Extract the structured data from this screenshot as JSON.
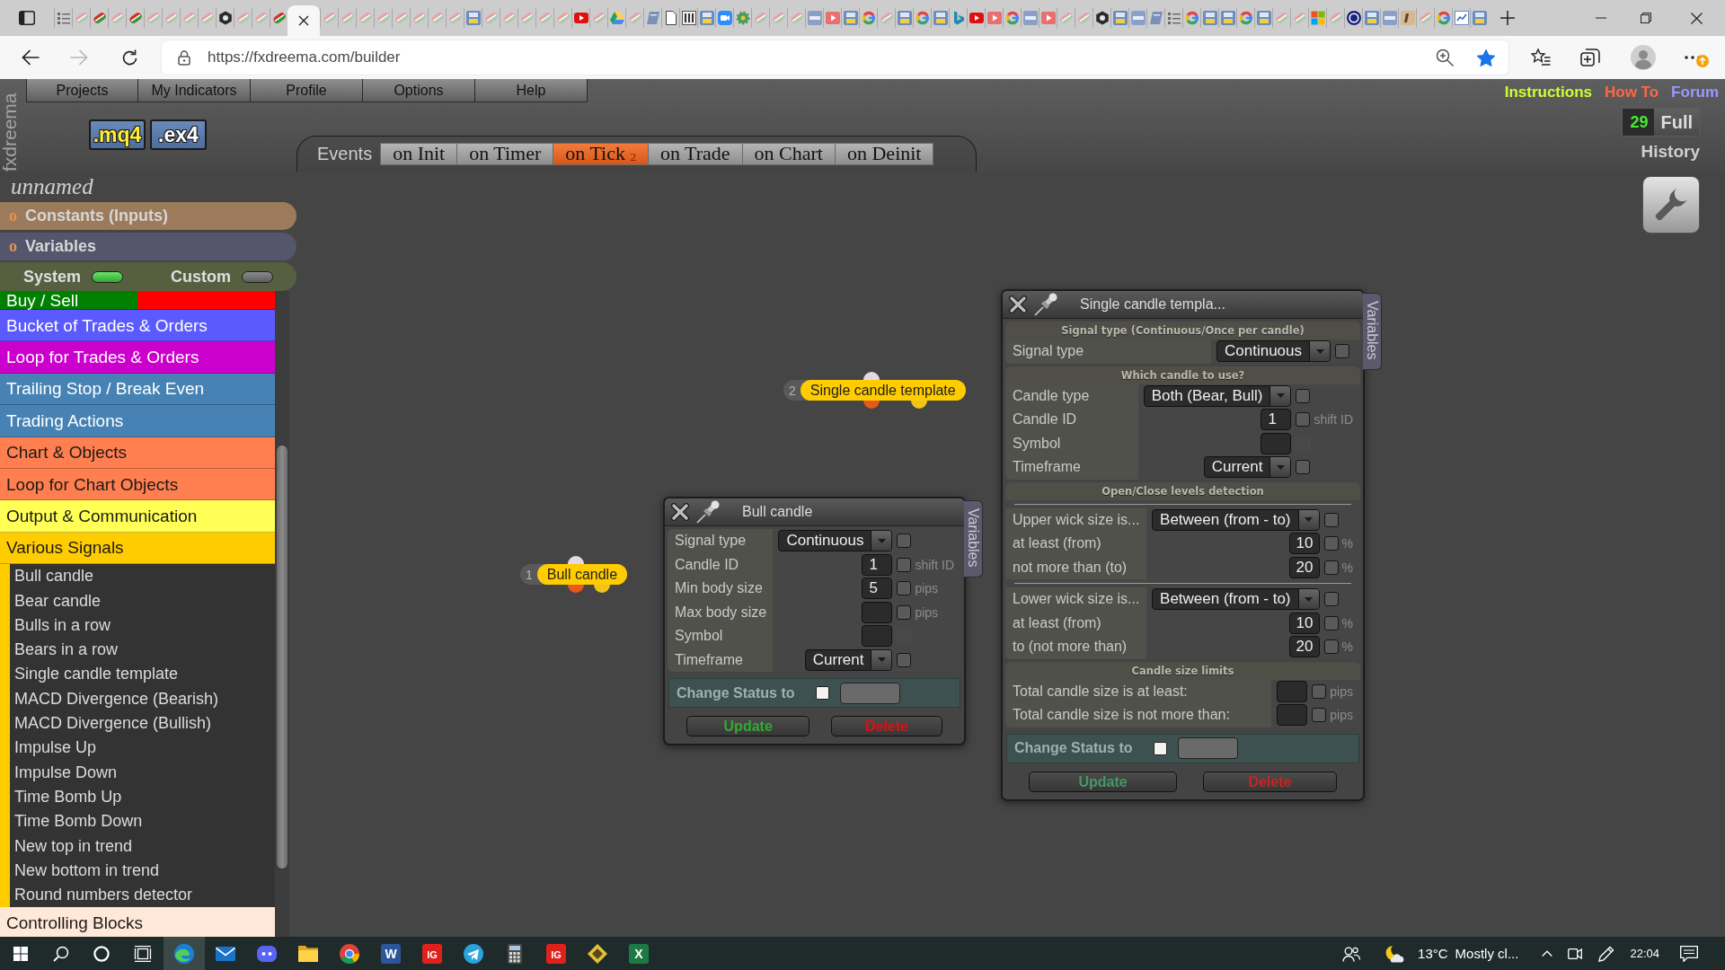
{
  "browser": {
    "tabs": [
      {
        "kind": "list",
        "selected": false
      },
      {
        "kind": "faded",
        "selected": false
      },
      {
        "kind": "swirl",
        "selected": false
      },
      {
        "kind": "faded",
        "selected": false
      },
      {
        "kind": "swirl",
        "selected": false
      },
      {
        "kind": "faded",
        "selected": false
      },
      {
        "kind": "faded",
        "selected": false
      },
      {
        "kind": "faded",
        "selected": false
      },
      {
        "kind": "faded",
        "selected": false
      },
      {
        "kind": "hexagon",
        "selected": false
      },
      {
        "kind": "faded",
        "selected": false
      },
      {
        "kind": "faded",
        "selected": false
      },
      {
        "kind": "swirl",
        "selected": false
      },
      {
        "selected": true
      },
      {
        "kind": "faded",
        "selected": false
      },
      {
        "kind": "faded",
        "selected": false
      },
      {
        "kind": "faded",
        "selected": false
      },
      {
        "kind": "faded",
        "selected": false
      },
      {
        "kind": "faded",
        "selected": false
      },
      {
        "kind": "faded",
        "selected": false
      },
      {
        "kind": "faded",
        "selected": false
      },
      {
        "kind": "faded",
        "selected": false
      },
      {
        "kind": "tile",
        "selected": false
      },
      {
        "kind": "faded",
        "selected": false
      },
      {
        "kind": "faded",
        "selected": false
      },
      {
        "kind": "faded",
        "selected": false
      },
      {
        "kind": "faded",
        "selected": false
      },
      {
        "kind": "faded",
        "selected": false
      },
      {
        "kind": "video",
        "selected": false
      },
      {
        "kind": "faded",
        "selected": false
      },
      {
        "kind": "triangle",
        "selected": false
      },
      {
        "kind": "faded",
        "selected": false
      },
      {
        "kind": "book",
        "selected": false
      },
      {
        "kind": "page",
        "selected": false
      },
      {
        "kind": "bars",
        "selected": false
      },
      {
        "kind": "tile",
        "selected": false
      },
      {
        "kind": "camera",
        "selected": false
      },
      {
        "kind": "gear",
        "selected": false
      },
      {
        "kind": "faded",
        "selected": false
      },
      {
        "kind": "faded",
        "selected": false
      },
      {
        "kind": "faded",
        "selected": false
      },
      {
        "kind": "database",
        "selected": false
      },
      {
        "kind": "play",
        "selected": false
      },
      {
        "kind": "tile",
        "selected": false
      },
      {
        "kind": "ring",
        "selected": false
      },
      {
        "kind": "faded",
        "selected": false
      },
      {
        "kind": "tile",
        "selected": false
      },
      {
        "kind": "ring",
        "selected": false
      },
      {
        "kind": "tile",
        "selected": false
      },
      {
        "kind": "ribbon",
        "selected": false
      },
      {
        "kind": "video",
        "selected": false
      },
      {
        "kind": "play",
        "selected": false
      },
      {
        "kind": "ring",
        "selected": false
      },
      {
        "kind": "database",
        "selected": false
      },
      {
        "kind": "play",
        "selected": false
      },
      {
        "kind": "faded",
        "selected": false
      },
      {
        "kind": "faded",
        "selected": false
      },
      {
        "kind": "hexagon",
        "selected": false
      },
      {
        "kind": "tile",
        "selected": false
      },
      {
        "kind": "database",
        "selected": false
      },
      {
        "kind": "book",
        "selected": false
      },
      {
        "kind": "list",
        "selected": false
      },
      {
        "kind": "ring",
        "selected": false
      },
      {
        "kind": "tile",
        "selected": false
      },
      {
        "kind": "tile",
        "selected": false
      },
      {
        "kind": "ring",
        "selected": false
      },
      {
        "kind": "tile",
        "selected": false
      },
      {
        "kind": "faded",
        "selected": false
      },
      {
        "kind": "faded",
        "selected": false
      },
      {
        "kind": "squares",
        "selected": false
      },
      {
        "kind": "faded",
        "selected": false
      },
      {
        "kind": "circle",
        "selected": false
      },
      {
        "kind": "tile",
        "selected": false
      },
      {
        "kind": "database",
        "selected": false
      },
      {
        "kind": "tan",
        "selected": false
      },
      {
        "kind": "faded",
        "selected": false
      },
      {
        "kind": "ring",
        "selected": false
      },
      {
        "kind": "chart",
        "selected": false
      },
      {
        "kind": "tile",
        "selected": false
      }
    ],
    "navigation": {
      "forward_disabled": true
    },
    "address": {
      "url": "https://fxdreema.com/builder",
      "bookmarked": true
    }
  },
  "app": {
    "logo": "fxdreema",
    "menu": [
      "Projects",
      "My Indicators",
      "Profile",
      "Options",
      "Help"
    ],
    "exports": [
      {
        "label": ".mq4",
        "kind": "source"
      },
      {
        "label": ".ex4",
        "kind": "compiled"
      }
    ],
    "events": {
      "label": "Events",
      "tabs": [
        {
          "label": "on Init",
          "selected": false
        },
        {
          "label": "on Timer",
          "selected": false
        },
        {
          "label": "on Tick $_{2}$",
          "selected": true
        },
        {
          "label": "on Trade",
          "selected": false
        },
        {
          "label": "on Chart",
          "selected": false
        },
        {
          "label": "on Deinit",
          "selected": false
        }
      ]
    },
    "links": [
      {
        "label": "Instructions",
        "color": "#ccff33"
      },
      {
        "label": "How To",
        "color": "#ff6644"
      },
      {
        "label": "Forum",
        "color": "#9999ff"
      }
    ],
    "history": {
      "count": "29",
      "button": "Full",
      "label": "History"
    }
  },
  "sidebar": {
    "project_name": "unnamed",
    "sections": [
      {
        "marker": "o",
        "label": "Constants (Inputs)",
        "color": "#9b7b5b"
      },
      {
        "marker": "o",
        "label": "Variables",
        "color": "#55556b"
      }
    ],
    "toggles": [
      {
        "label": "System",
        "on": true
      },
      {
        "label": "Custom",
        "on": false
      }
    ],
    "categories": [
      {
        "label": "Buy / Sell",
        "parts": [
          {
            "color": "#008000"
          },
          {
            "color": "#ff0000"
          }
        ]
      },
      {
        "label": "Bucket of Trades & Orders",
        "color": "#5a5aff"
      },
      {
        "label": "Loop for Trades & Orders",
        "color": "#cc00cc"
      },
      {
        "label": "Trailing Stop / Break Even",
        "color": "#4682b4"
      },
      {
        "label": "Trading Actions",
        "color": "#4682b4"
      },
      {
        "label": "Chart & Objects",
        "color": "#ff7f50"
      },
      {
        "label": "Loop for Chart Objects",
        "color": "#ff7f50"
      },
      {
        "label": "Output & Communication",
        "color": "#ffff55"
      },
      {
        "label": "Various Signals",
        "color": "#ffcc00",
        "children": [
          {
            "label": "Bull candle"
          },
          {
            "label": "Bear candle"
          },
          {
            "label": "Bulls in a row"
          },
          {
            "label": "Bears in a row"
          },
          {
            "label": "Single candle template"
          },
          {
            "label": "MACD Divergence (Bearish)"
          },
          {
            "label": "MACD Divergence (Bullish)"
          },
          {
            "label": "Impulse Up"
          },
          {
            "label": "Impulse Down"
          },
          {
            "label": "Time Bomb Up"
          },
          {
            "label": "Time Bomb Down"
          },
          {
            "label": "New top in trend"
          },
          {
            "label": "New bottom in trend"
          },
          {
            "label": "Round numbers detector"
          }
        ]
      },
      {
        "label": "Controlling Blocks",
        "color": "#ffe8d8"
      }
    ]
  },
  "canvas": {
    "nodes": [
      {
        "number": "2",
        "label": "Single candle template"
      },
      {
        "number": "1",
        "label": "Bull candle"
      }
    ],
    "dialogs": [
      {
        "title": "Single candle templa...",
        "side_tab": "Variables",
        "groups": [
          {
            "heading": "Signal type (Continuous/Once per candle)",
            "rows": [
              {
                "kind": "select",
                "label": "Signal type",
                "value": "Continuous",
                "checkbox": {
                  "checked": false,
                  "disabled": false
                }
              }
            ]
          },
          {
            "heading": "Which candle to use?",
            "rows": [
              {
                "kind": "select",
                "label": "Candle type",
                "value": "Both (Bear, Bull)",
                "checkbox": {
                  "checked": false,
                  "disabled": false
                }
              },
              {
                "kind": "input",
                "label": "Candle ID",
                "value": "1",
                "unit": "shift ID",
                "checkbox": {
                  "checked": false,
                  "disabled": false
                }
              },
              {
                "kind": "input",
                "label": "Symbol",
                "checkbox": {
                  "checked": false,
                  "disabled": true
                }
              },
              {
                "kind": "select",
                "label": "Timeframe",
                "value": "Current",
                "checkbox": {
                  "checked": false,
                  "disabled": false
                }
              }
            ]
          },
          {
            "heading": "Open/Close levels detection",
            "sections": [
              [
                {
                  "kind": "select",
                  "label": "Upper wick size is...",
                  "value": "Between (from - to)",
                  "checkbox": {
                    "checked": false,
                    "disabled": false
                  }
                },
                {
                  "kind": "input",
                  "label": "at least (from)",
                  "value": "10",
                  "unit": "%",
                  "checkbox": {
                    "checked": false,
                    "disabled": false
                  }
                },
                {
                  "kind": "input",
                  "label": "not more than (to)",
                  "value": "20",
                  "unit": "%",
                  "checkbox": {
                    "checked": false,
                    "disabled": false
                  }
                }
              ],
              [
                {
                  "kind": "select",
                  "label": "Lower wick size is...",
                  "value": "Between (from - to)",
                  "checkbox": {
                    "checked": false,
                    "disabled": false
                  }
                },
                {
                  "kind": "input",
                  "label": "at least (from)",
                  "value": "10",
                  "unit": "%",
                  "checkbox": {
                    "checked": false,
                    "disabled": false
                  }
                },
                {
                  "kind": "input",
                  "label": "to (not more than)",
                  "value": "20",
                  "unit": "%",
                  "checkbox": {
                    "checked": false,
                    "disabled": false
                  }
                }
              ]
            ]
          },
          {
            "heading": "Candle size limits",
            "rows": [
              {
                "kind": "input",
                "label": "Total candle size is at least:",
                "unit": "pips",
                "checkbox": {
                  "checked": false,
                  "disabled": false
                }
              },
              {
                "kind": "input",
                "label": "Total candle size is not more than:",
                "unit": "pips",
                "checkbox": {
                  "checked": false,
                  "disabled": false
                }
              }
            ]
          }
        ],
        "status": {
          "label": "Change Status to",
          "checked": false
        },
        "buttons": [
          {
            "label": "Update",
            "color": "#449966"
          },
          {
            "label": "Delete",
            "color": "#cc2222"
          }
        ]
      },
      {
        "title": "Bull candle",
        "side_tab": "Variables",
        "groups": [
          {
            "rows": [
              {
                "kind": "select",
                "label": "Signal type",
                "value": "Continuous",
                "checkbox": {
                  "checked": false,
                  "disabled": false
                }
              },
              {
                "kind": "input",
                "label": "Candle ID",
                "value": "1",
                "unit": "shift ID",
                "checkbox": {
                  "checked": false,
                  "disabled": false
                }
              },
              {
                "kind": "input",
                "label": "Min body size",
                "value": "5",
                "unit": "pips",
                "checkbox": {
                  "checked": false,
                  "disabled": false
                }
              },
              {
                "kind": "input",
                "label": "Max body size",
                "unit": "pips",
                "checkbox": {
                  "checked": false,
                  "disabled": false
                }
              },
              {
                "kind": "input",
                "label": "Symbol",
                "checkbox": {
                  "checked": false,
                  "disabled": true
                }
              },
              {
                "kind": "select",
                "label": "Timeframe",
                "value": "Current",
                "checkbox": {
                  "checked": false,
                  "disabled": false
                }
              }
            ]
          }
        ],
        "status": {
          "label": "Change Status to",
          "checked": false
        },
        "buttons": [
          {
            "label": "Update",
            "color": "#33aa33"
          },
          {
            "label": "Delete",
            "color": "#dd1111"
          }
        ]
      }
    ]
  },
  "taskbar": {
    "apps": [
      {
        "kind": "browser",
        "selected": true
      },
      {
        "kind": "mail",
        "selected": false
      },
      {
        "kind": "chat",
        "selected": false
      },
      {
        "kind": "folder",
        "selected": false
      },
      {
        "kind": "ring",
        "selected": false
      },
      {
        "kind": "tile",
        "glyph": "W",
        "color": "#2b579a",
        "selected": false
      },
      {
        "kind": "tile",
        "glyph": "IG",
        "color": "#e0201b",
        "selected": false
      },
      {
        "kind": "plane",
        "selected": false
      },
      {
        "kind": "calculator",
        "selected": false
      },
      {
        "kind": "tile",
        "glyph": "IG",
        "color": "#e0201b",
        "selected": false
      },
      {
        "kind": "diamond",
        "selected": false
      },
      {
        "kind": "tile",
        "glyph": "X",
        "color": "#1d7a45",
        "selected": false
      }
    ],
    "temperature": "13°C",
    "weather": "Mostly cl...",
    "time": "22:04"
  }
}
